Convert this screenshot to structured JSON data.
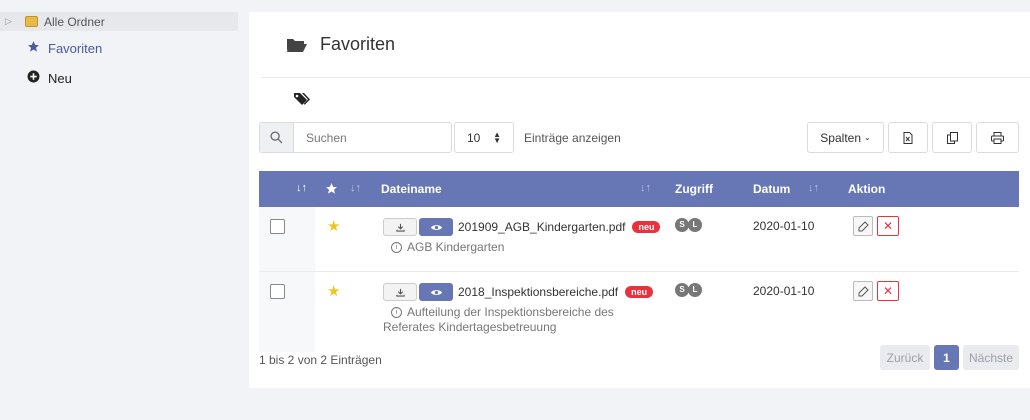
{
  "sidebar": {
    "tree_root": "Alle Ordner",
    "items": [
      {
        "label": "Favoriten",
        "icon": "star-icon"
      },
      {
        "label": "Neu",
        "icon": "plus-circle-icon"
      }
    ]
  },
  "main": {
    "title": "Favoriten",
    "search": {
      "placeholder": "Suchen"
    },
    "page_size": "10",
    "entries_label": "Einträge anzeigen",
    "columns_button": "Spalten",
    "table": {
      "headers": {
        "file": "Dateiname",
        "access": "Zugriff",
        "date": "Datum",
        "action": "Aktion"
      },
      "rows": [
        {
          "file": "201909_AGB_Kindergarten.pdf",
          "badge": "neu",
          "description": "AGB Kindergarten",
          "access": [
            "S",
            "L"
          ],
          "date": "2020-01-10"
        },
        {
          "file": "2018_Inspektionsbereiche.pdf",
          "badge": "neu",
          "description": "Aufteilung der Inspektionsbereiche des Referates Kindertagesbetreuung",
          "access": [
            "S",
            "L"
          ],
          "date": "2020-01-10"
        }
      ]
    },
    "footer": {
      "summary": "1 bis 2 von 2 Einträgen",
      "prev": "Zurück",
      "page": "1",
      "next": "Nächste"
    }
  },
  "colors": {
    "accent": "#6777b5",
    "danger": "#e8333f",
    "star": "#f2c423"
  }
}
